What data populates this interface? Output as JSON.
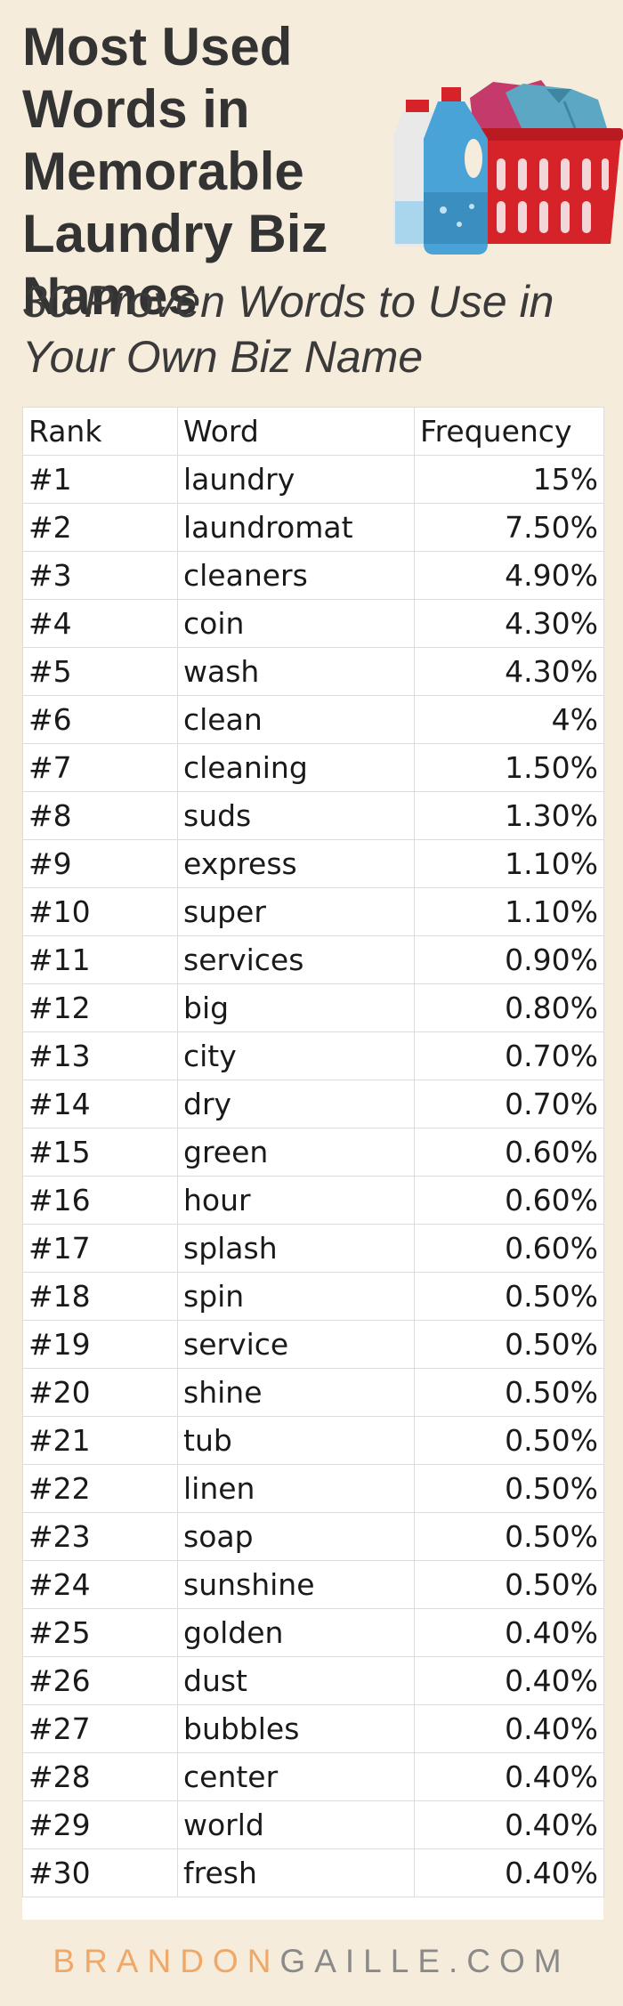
{
  "title": "Most Used Words in Memorable Laundry Biz Names",
  "subtitle": "30 Proven Words to Use in Your Own Biz Name",
  "illustration": {
    "icons": [
      "shirt-icon",
      "laundry-basket-icon",
      "detergent-bottle-icon",
      "bleach-bottle-icon"
    ],
    "colors": {
      "basket": "#d6232a",
      "shirt_blue": "#5ca8c4",
      "shirt_pink": "#c43a6a",
      "bottle": "#4aa3d6"
    }
  },
  "table": {
    "headers": [
      "Rank",
      "Word",
      "Frequency"
    ],
    "rows": [
      {
        "rank": "#1",
        "word": "laundry",
        "frequency": "15%"
      },
      {
        "rank": "#2",
        "word": "laundromat",
        "frequency": "7.50%"
      },
      {
        "rank": "#3",
        "word": "cleaners",
        "frequency": "4.90%"
      },
      {
        "rank": "#4",
        "word": "coin",
        "frequency": "4.30%"
      },
      {
        "rank": "#5",
        "word": "wash",
        "frequency": "4.30%"
      },
      {
        "rank": "#6",
        "word": "clean",
        "frequency": "4%"
      },
      {
        "rank": "#7",
        "word": "cleaning",
        "frequency": "1.50%"
      },
      {
        "rank": "#8",
        "word": "suds",
        "frequency": "1.30%"
      },
      {
        "rank": "#9",
        "word": "express",
        "frequency": "1.10%"
      },
      {
        "rank": "#10",
        "word": "super",
        "frequency": "1.10%"
      },
      {
        "rank": "#11",
        "word": "services",
        "frequency": "0.90%"
      },
      {
        "rank": "#12",
        "word": "big",
        "frequency": "0.80%"
      },
      {
        "rank": "#13",
        "word": "city",
        "frequency": "0.70%"
      },
      {
        "rank": "#14",
        "word": "dry",
        "frequency": "0.70%"
      },
      {
        "rank": "#15",
        "word": "green",
        "frequency": "0.60%"
      },
      {
        "rank": "#16",
        "word": "hour",
        "frequency": "0.60%"
      },
      {
        "rank": "#17",
        "word": "splash",
        "frequency": "0.60%"
      },
      {
        "rank": "#18",
        "word": "spin",
        "frequency": "0.50%"
      },
      {
        "rank": "#19",
        "word": "service",
        "frequency": "0.50%"
      },
      {
        "rank": "#20",
        "word": "shine",
        "frequency": "0.50%"
      },
      {
        "rank": "#21",
        "word": "tub",
        "frequency": "0.50%"
      },
      {
        "rank": "#22",
        "word": "linen",
        "frequency": "0.50%"
      },
      {
        "rank": "#23",
        "word": "soap",
        "frequency": "0.50%"
      },
      {
        "rank": "#24",
        "word": "sunshine",
        "frequency": "0.50%"
      },
      {
        "rank": "#25",
        "word": "golden",
        "frequency": "0.40%"
      },
      {
        "rank": "#26",
        "word": "dust",
        "frequency": "0.40%"
      },
      {
        "rank": "#27",
        "word": "bubbles",
        "frequency": "0.40%"
      },
      {
        "rank": "#28",
        "word": "center",
        "frequency": "0.40%"
      },
      {
        "rank": "#29",
        "word": "world",
        "frequency": "0.40%"
      },
      {
        "rank": "#30",
        "word": "fresh",
        "frequency": "0.40%"
      }
    ]
  },
  "footer": {
    "brand_part1": "BRANDON",
    "brand_part2": "GAILLE.COM"
  },
  "colors": {
    "background": "#f5ecdb",
    "brand_accent": "#f0a868",
    "brand_gray": "#8a8a8a"
  }
}
